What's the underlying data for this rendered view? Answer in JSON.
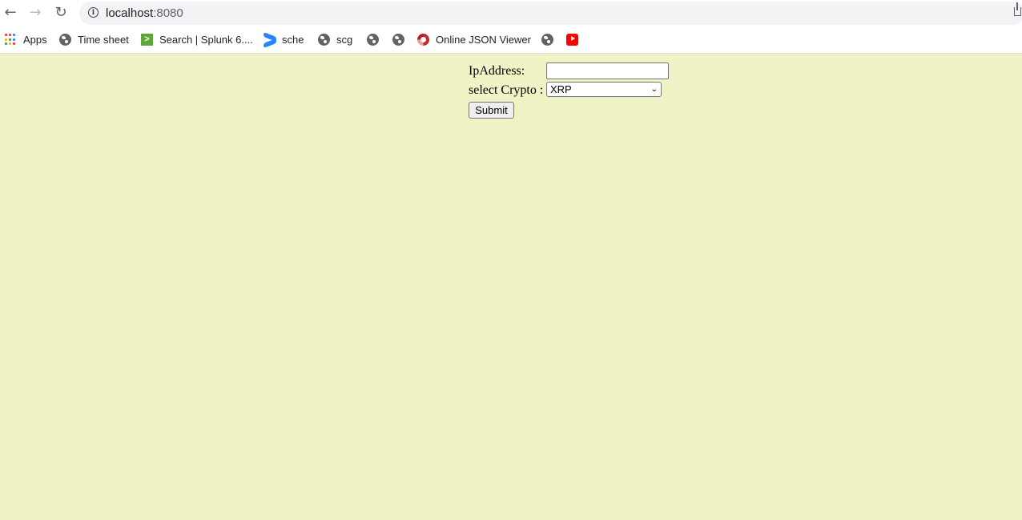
{
  "browser": {
    "url_host": "localhost",
    "url_port": ":8080",
    "back_glyph": "←",
    "forward_glyph": "→",
    "reload_glyph": "↻",
    "info_glyph": "i"
  },
  "bookmarks": [
    {
      "label": "Apps",
      "icon": "apps-grid-icon"
    },
    {
      "label": "Time sheet",
      "icon": "globe-icon"
    },
    {
      "label": "Search | Splunk 6....",
      "icon": "splunk-icon",
      "icon_text": ">"
    },
    {
      "label": "sche",
      "icon": "confluence-icon"
    },
    {
      "label": "scg",
      "icon": "globe-icon"
    },
    {
      "label": "",
      "icon": "globe-icon"
    },
    {
      "label": "",
      "icon": "globe-icon"
    },
    {
      "label": "Online JSON Viewer",
      "icon": "json-viewer-icon"
    },
    {
      "label": "",
      "icon": "globe-icon"
    },
    {
      "label": "",
      "icon": "youtube-icon"
    }
  ],
  "form": {
    "ip_label": "IpAddress:",
    "ip_value": "",
    "crypto_label": "select Crypto :",
    "crypto_selected": "XRP",
    "submit_label": "Submit"
  },
  "colors": {
    "page_background": "#eff3c5",
    "splunk_green": "#5ca73a",
    "youtube_red": "#ff0000",
    "confluence_blue": "#2684ff"
  }
}
